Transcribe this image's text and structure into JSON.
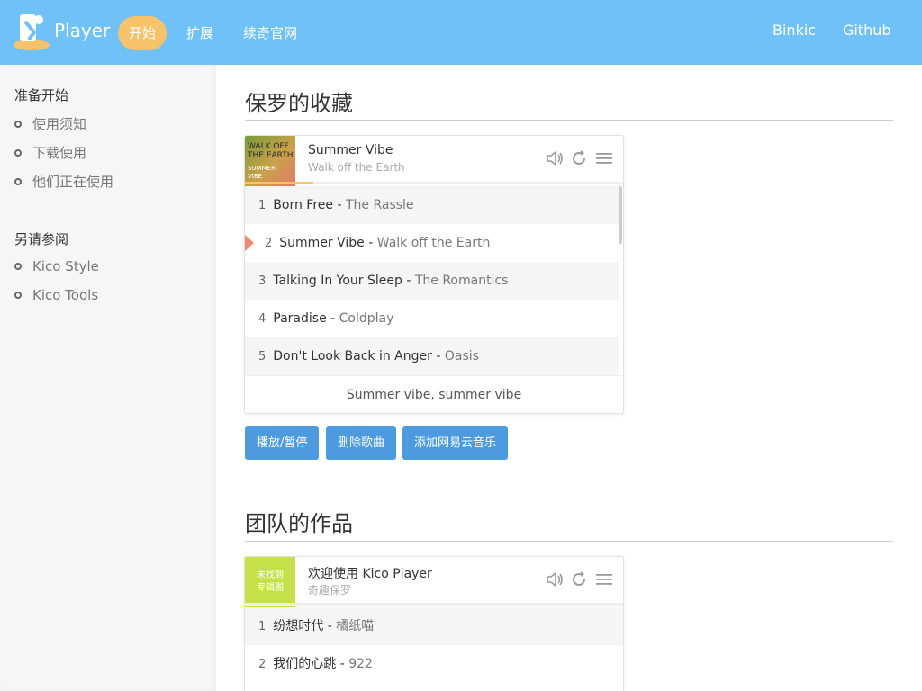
{
  "header": {
    "brand": "Player",
    "nav": [
      {
        "label": "开始",
        "active": true
      },
      {
        "label": "扩展",
        "active": false
      },
      {
        "label": "续奇官网",
        "active": false
      }
    ],
    "right": [
      "Binkic",
      "Github"
    ]
  },
  "sidebar": {
    "groups": [
      {
        "title": "准备开始",
        "items": [
          "使用须知",
          "下载使用",
          "他们正在使用"
        ]
      },
      {
        "title": "另请参阅",
        "items": [
          "Kico Style",
          "Kico Tools"
        ]
      }
    ]
  },
  "section1": {
    "title": "保罗的收藏",
    "player": {
      "current_title": "Summer Vibe",
      "current_artist": "Walk off the Earth",
      "cover_text": [
        "WALK OFF",
        "THE EARTH",
        "SUMMER",
        "VIBE"
      ],
      "progress": 0.18,
      "tracks": [
        {
          "num": "1",
          "title": "Born Free",
          "artist": "The Rassle"
        },
        {
          "num": "2",
          "title": "Summer Vibe",
          "artist": "Walk off the Earth"
        },
        {
          "num": "3",
          "title": "Talking In Your Sleep",
          "artist": "The Romantics"
        },
        {
          "num": "4",
          "title": "Paradise",
          "artist": "Coldplay"
        },
        {
          "num": "5",
          "title": "Don't Look Back in Anger",
          "artist": "Oasis"
        }
      ],
      "current_index": 1,
      "lyric": "Summer vibe, summer vibe"
    },
    "buttons": [
      "播放/暂停",
      "删除歌曲",
      "添加网易云音乐"
    ]
  },
  "section2": {
    "title": "团队的作品",
    "player": {
      "current_title": "欢迎使用 Kico Player",
      "current_artist": "奇趣保罗",
      "cover_text": [
        "未找到",
        "专辑图"
      ],
      "tracks": [
        {
          "num": "1",
          "title": "纷想时代",
          "artist": "橘纸喵"
        },
        {
          "num": "2",
          "title": "我们的心跳",
          "artist": "922"
        }
      ]
    }
  },
  "colors": {
    "header_bg": "#70c1f8",
    "active_nav": "#f6c36b",
    "button_bg": "#4d9bde",
    "current_marker": "#f08a6f",
    "cover2_bg": "#c6e04a"
  }
}
